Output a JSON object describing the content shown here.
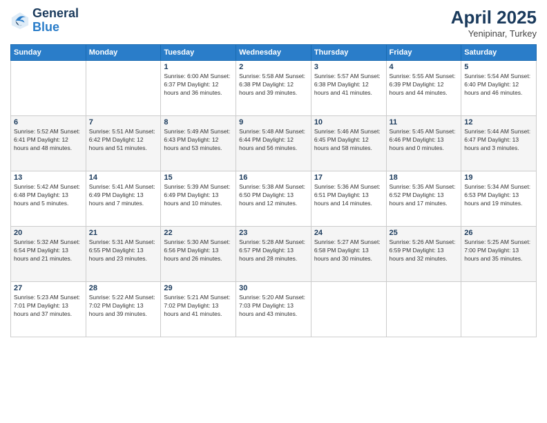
{
  "logo": {
    "line1": "General",
    "line2": "Blue"
  },
  "title": "April 2025",
  "subtitle": "Yenipinar, Turkey",
  "weekdays": [
    "Sunday",
    "Monday",
    "Tuesday",
    "Wednesday",
    "Thursday",
    "Friday",
    "Saturday"
  ],
  "weeks": [
    [
      {
        "day": "",
        "info": ""
      },
      {
        "day": "",
        "info": ""
      },
      {
        "day": "1",
        "info": "Sunrise: 6:00 AM\nSunset: 6:37 PM\nDaylight: 12 hours\nand 36 minutes."
      },
      {
        "day": "2",
        "info": "Sunrise: 5:58 AM\nSunset: 6:38 PM\nDaylight: 12 hours\nand 39 minutes."
      },
      {
        "day": "3",
        "info": "Sunrise: 5:57 AM\nSunset: 6:38 PM\nDaylight: 12 hours\nand 41 minutes."
      },
      {
        "day": "4",
        "info": "Sunrise: 5:55 AM\nSunset: 6:39 PM\nDaylight: 12 hours\nand 44 minutes."
      },
      {
        "day": "5",
        "info": "Sunrise: 5:54 AM\nSunset: 6:40 PM\nDaylight: 12 hours\nand 46 minutes."
      }
    ],
    [
      {
        "day": "6",
        "info": "Sunrise: 5:52 AM\nSunset: 6:41 PM\nDaylight: 12 hours\nand 48 minutes."
      },
      {
        "day": "7",
        "info": "Sunrise: 5:51 AM\nSunset: 6:42 PM\nDaylight: 12 hours\nand 51 minutes."
      },
      {
        "day": "8",
        "info": "Sunrise: 5:49 AM\nSunset: 6:43 PM\nDaylight: 12 hours\nand 53 minutes."
      },
      {
        "day": "9",
        "info": "Sunrise: 5:48 AM\nSunset: 6:44 PM\nDaylight: 12 hours\nand 56 minutes."
      },
      {
        "day": "10",
        "info": "Sunrise: 5:46 AM\nSunset: 6:45 PM\nDaylight: 12 hours\nand 58 minutes."
      },
      {
        "day": "11",
        "info": "Sunrise: 5:45 AM\nSunset: 6:46 PM\nDaylight: 13 hours\nand 0 minutes."
      },
      {
        "day": "12",
        "info": "Sunrise: 5:44 AM\nSunset: 6:47 PM\nDaylight: 13 hours\nand 3 minutes."
      }
    ],
    [
      {
        "day": "13",
        "info": "Sunrise: 5:42 AM\nSunset: 6:48 PM\nDaylight: 13 hours\nand 5 minutes."
      },
      {
        "day": "14",
        "info": "Sunrise: 5:41 AM\nSunset: 6:49 PM\nDaylight: 13 hours\nand 7 minutes."
      },
      {
        "day": "15",
        "info": "Sunrise: 5:39 AM\nSunset: 6:49 PM\nDaylight: 13 hours\nand 10 minutes."
      },
      {
        "day": "16",
        "info": "Sunrise: 5:38 AM\nSunset: 6:50 PM\nDaylight: 13 hours\nand 12 minutes."
      },
      {
        "day": "17",
        "info": "Sunrise: 5:36 AM\nSunset: 6:51 PM\nDaylight: 13 hours\nand 14 minutes."
      },
      {
        "day": "18",
        "info": "Sunrise: 5:35 AM\nSunset: 6:52 PM\nDaylight: 13 hours\nand 17 minutes."
      },
      {
        "day": "19",
        "info": "Sunrise: 5:34 AM\nSunset: 6:53 PM\nDaylight: 13 hours\nand 19 minutes."
      }
    ],
    [
      {
        "day": "20",
        "info": "Sunrise: 5:32 AM\nSunset: 6:54 PM\nDaylight: 13 hours\nand 21 minutes."
      },
      {
        "day": "21",
        "info": "Sunrise: 5:31 AM\nSunset: 6:55 PM\nDaylight: 13 hours\nand 23 minutes."
      },
      {
        "day": "22",
        "info": "Sunrise: 5:30 AM\nSunset: 6:56 PM\nDaylight: 13 hours\nand 26 minutes."
      },
      {
        "day": "23",
        "info": "Sunrise: 5:28 AM\nSunset: 6:57 PM\nDaylight: 13 hours\nand 28 minutes."
      },
      {
        "day": "24",
        "info": "Sunrise: 5:27 AM\nSunset: 6:58 PM\nDaylight: 13 hours\nand 30 minutes."
      },
      {
        "day": "25",
        "info": "Sunrise: 5:26 AM\nSunset: 6:59 PM\nDaylight: 13 hours\nand 32 minutes."
      },
      {
        "day": "26",
        "info": "Sunrise: 5:25 AM\nSunset: 7:00 PM\nDaylight: 13 hours\nand 35 minutes."
      }
    ],
    [
      {
        "day": "27",
        "info": "Sunrise: 5:23 AM\nSunset: 7:01 PM\nDaylight: 13 hours\nand 37 minutes."
      },
      {
        "day": "28",
        "info": "Sunrise: 5:22 AM\nSunset: 7:02 PM\nDaylight: 13 hours\nand 39 minutes."
      },
      {
        "day": "29",
        "info": "Sunrise: 5:21 AM\nSunset: 7:02 PM\nDaylight: 13 hours\nand 41 minutes."
      },
      {
        "day": "30",
        "info": "Sunrise: 5:20 AM\nSunset: 7:03 PM\nDaylight: 13 hours\nand 43 minutes."
      },
      {
        "day": "",
        "info": ""
      },
      {
        "day": "",
        "info": ""
      },
      {
        "day": "",
        "info": ""
      }
    ]
  ]
}
